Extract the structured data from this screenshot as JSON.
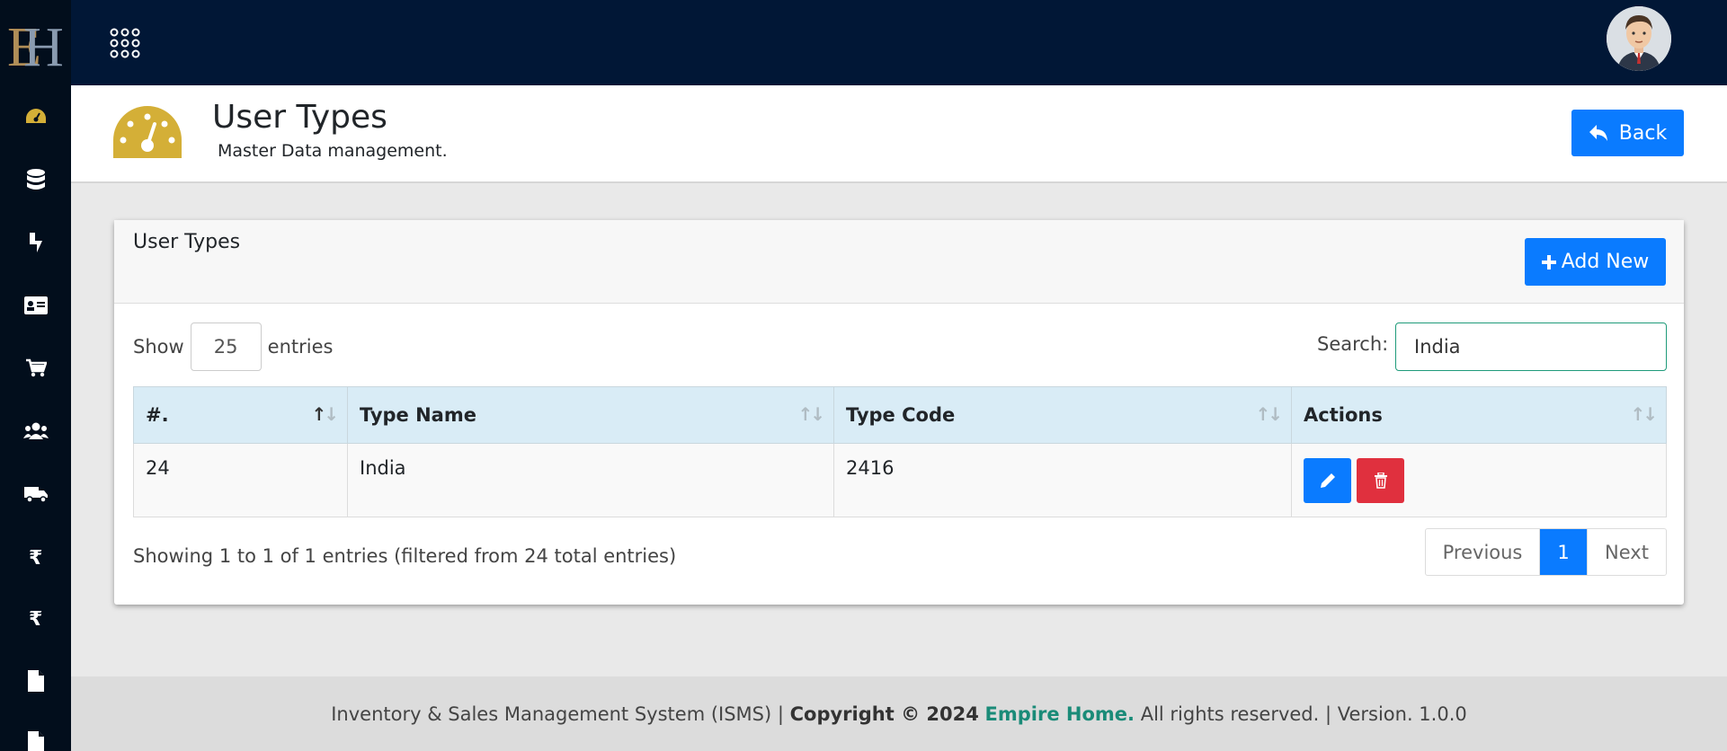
{
  "brand": {
    "logo_text": "EH"
  },
  "header": {
    "title": "User Types",
    "subtitle": "Master Data management.",
    "back_label": "Back"
  },
  "card": {
    "title": "User Types",
    "add_label": "Add New",
    "show_label": "Show",
    "show_value": "25",
    "entries_label": "entries",
    "search_label": "Search:",
    "search_value": "India"
  },
  "table": {
    "columns": [
      "#.",
      "Type Name",
      "Type Code",
      "Actions"
    ],
    "rows": [
      {
        "num": "24",
        "type_name": "India",
        "type_code": "2416"
      }
    ]
  },
  "pagination": {
    "info": "Showing 1 to 1 of 1 entries (filtered from 24 total entries)",
    "previous": "Previous",
    "current": "1",
    "next": "Next"
  },
  "footer": {
    "system": "Inventory & Sales Management System (ISMS) |",
    "copyright": "Copyright © 2024",
    "company": "Empire Home.",
    "rights": "All rights reserved. | Version. 1.0.0"
  },
  "sidebar": {
    "icons": [
      "dashboard-icon",
      "database-icon",
      "brand-icon",
      "id-card-icon",
      "cart-icon",
      "users-icon",
      "truck-icon",
      "rupee-icon",
      "rupee-icon",
      "file-icon",
      "file-icon"
    ]
  },
  "colors": {
    "accent": "#0a7bff",
    "danger": "#e0303e",
    "topbar": "#011736",
    "sidebar": "#020e1c",
    "gold": "#d4af37",
    "brand_text": "#1a8b78"
  }
}
